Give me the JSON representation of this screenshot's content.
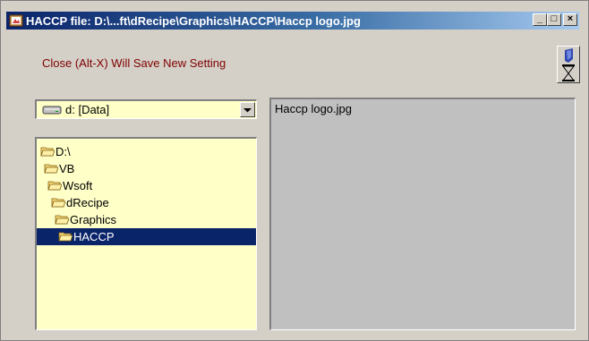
{
  "window": {
    "title": "HACCP file: D:\\...ft\\dRecipe\\Graphics\\HACCP\\Haccp logo.jpg",
    "minimize_label": "_",
    "maximize_label": "□",
    "close_label": "×"
  },
  "hint": "Close (Alt-X) Will Save New Setting",
  "drive": {
    "selected": "d: [Data]"
  },
  "folders": [
    {
      "label": "D:\\",
      "selected": false
    },
    {
      "label": "VB",
      "selected": false
    },
    {
      "label": "Wsoft",
      "selected": false
    },
    {
      "label": "dRecipe",
      "selected": false
    },
    {
      "label": "Graphics",
      "selected": false
    },
    {
      "label": "HACCP",
      "selected": true
    }
  ],
  "files": [
    "Haccp logo.jpg"
  ],
  "colors": {
    "title_gradient_start": "#0a246a",
    "title_gradient_end": "#a6caf0",
    "hint_text": "#800000",
    "list_background": "#ffffc8",
    "selection": "#0a246a",
    "face": "#d4d0c8"
  },
  "icons": {
    "app": "haccp-app-icon",
    "hourglass": "hourglass-icon",
    "drive": "hard-drive-icon",
    "folder": "open-folder-icon",
    "dropdown": "chevron-down-icon"
  }
}
